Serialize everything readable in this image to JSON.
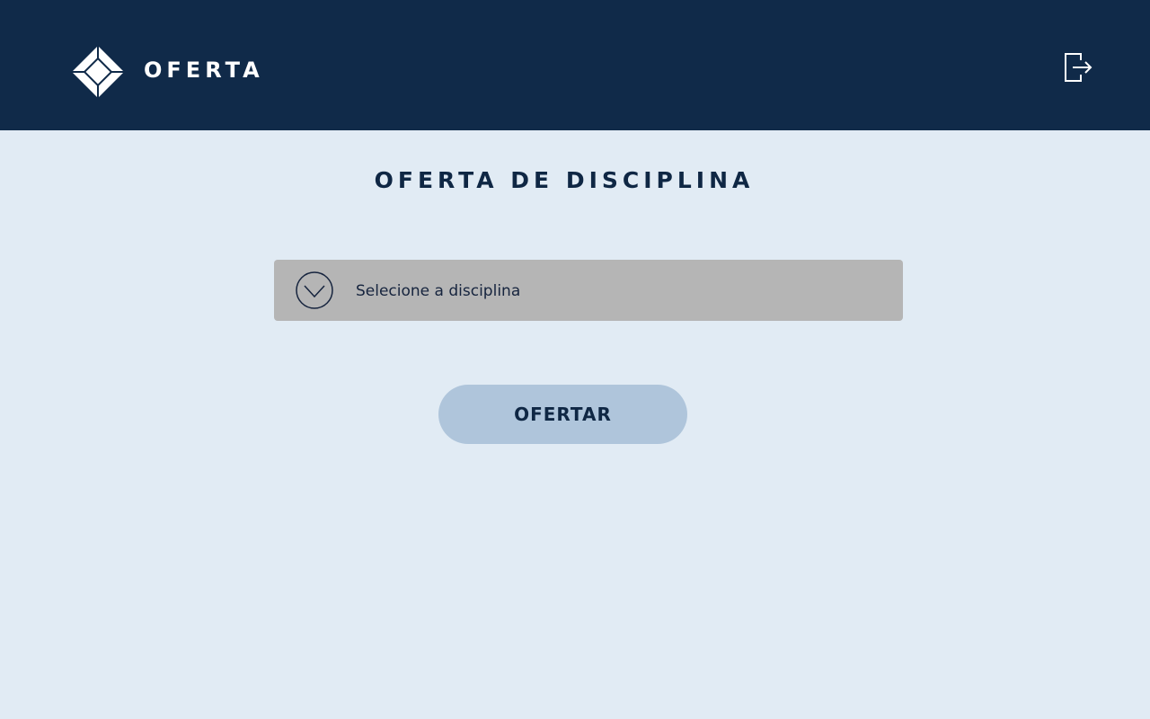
{
  "header": {
    "brand": "OFERTA",
    "logo_icon": "diamond-logo-icon",
    "logout_icon": "logout-icon",
    "background_color": "#102A49"
  },
  "main": {
    "title": "OFERTA DE DISCIPLINA",
    "discipline_select": {
      "placeholder": "Selecione a disciplina",
      "icon": "chevron-down-circle-icon"
    },
    "submit_button": {
      "label": "OFERTAR"
    }
  },
  "colors": {
    "page_background": "#E1EBF4",
    "select_background": "#B5B5B5",
    "button_background": "#AFC5DB",
    "text_dark": "#0F2744"
  }
}
